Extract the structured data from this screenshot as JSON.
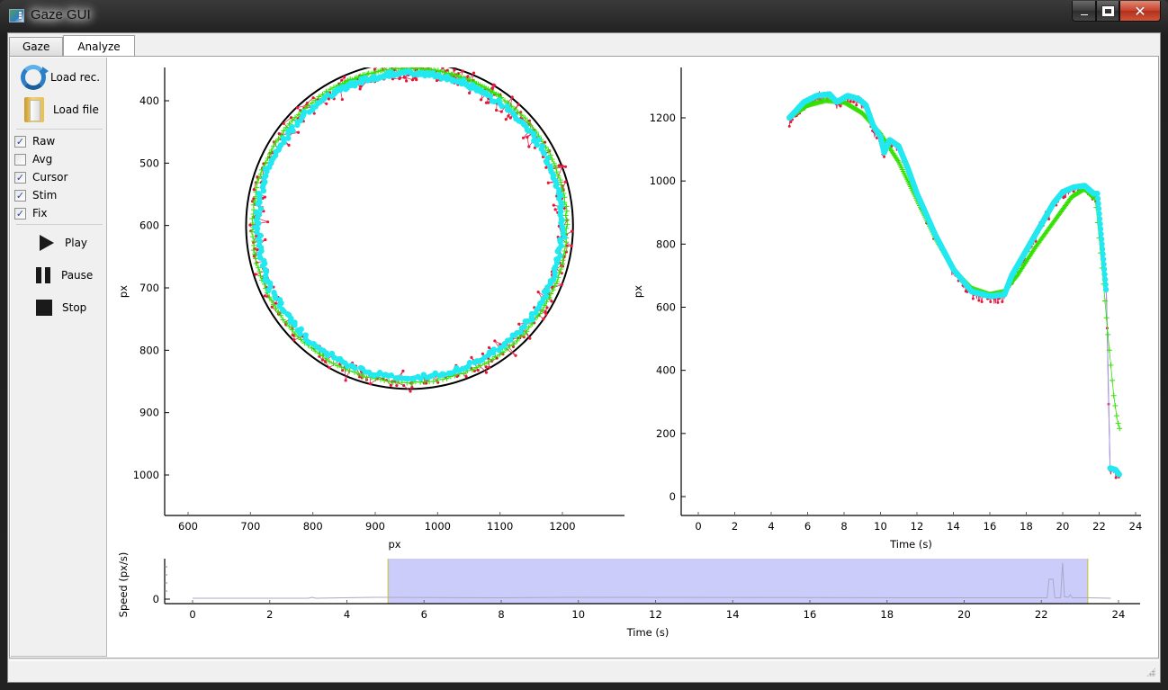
{
  "window": {
    "title": "Gaze GUI",
    "controls": {
      "minimize": "minimize",
      "maximize": "maximize",
      "close": "close"
    }
  },
  "tabs": [
    {
      "label": "Gaze",
      "active": false
    },
    {
      "label": "Analyze",
      "active": true
    }
  ],
  "sidebar": {
    "load_rec": {
      "label": "Load rec.",
      "icon": "refresh-icon"
    },
    "load_file": {
      "label": "Load file",
      "icon": "folder-icon"
    },
    "checkboxes": [
      {
        "label": "Raw",
        "checked": true
      },
      {
        "label": "Avg",
        "checked": false
      },
      {
        "label": "Cursor",
        "checked": true
      },
      {
        "label": "Stim",
        "checked": true
      },
      {
        "label": "Fix",
        "checked": true
      }
    ],
    "play": {
      "label": "Play",
      "icon": "play-icon"
    },
    "pause": {
      "label": "Pause",
      "icon": "pause-icon"
    },
    "stop": {
      "label": "Stop",
      "icon": "stop-icon"
    }
  },
  "colors": {
    "raw": "#e8173a",
    "raw_line": "#d8305a",
    "stim": "#33e000",
    "fix": "#22e8f0",
    "cursor": "#9a9af0",
    "target": "#000000",
    "selection": "#ccccfa",
    "selection_edge": "#c8c870",
    "speed_line": "#a8a8c8"
  },
  "chart_data": [
    {
      "id": "xy-plot",
      "type": "scatter",
      "title": "",
      "xlabel": "px",
      "ylabel": "px",
      "xlim": [
        565,
        1300
      ],
      "ylim": [
        345,
        1065
      ],
      "y_inverted": true,
      "xticks": [
        600,
        700,
        800,
        900,
        1000,
        1100,
        1200
      ],
      "yticks": [
        400,
        500,
        600,
        700,
        800,
        900,
        1000
      ],
      "target_circle": {
        "cx": 955,
        "cy": 600,
        "r": 262,
        "color": "#000000"
      },
      "series": [
        {
          "name": "Raw",
          "style": "dots+lines",
          "arc_deg": [
            -118,
            305
          ],
          "offset": -14,
          "noise": 24
        },
        {
          "name": "Stim",
          "style": "plus",
          "arc_deg": [
            -118,
            305
          ],
          "offset": -10,
          "noise": 2
        },
        {
          "name": "Fix",
          "style": "thick-dots",
          "arc_deg": [
            -120,
            300
          ],
          "offset": -18,
          "noise": 6
        }
      ]
    },
    {
      "id": "time-plot",
      "type": "line",
      "xlabel": "Time (s)",
      "ylabel": "px",
      "xlim": [
        -1,
        24.3
      ],
      "ylim": [
        -60,
        1340
      ],
      "xticks": [
        0,
        2,
        4,
        6,
        8,
        10,
        12,
        14,
        16,
        18,
        20,
        22,
        24
      ],
      "yticks": [
        0,
        200,
        400,
        600,
        800,
        1000,
        1200
      ],
      "series": [
        {
          "name": "Stim",
          "x": [
            5.0,
            6.0,
            7.0,
            8.0,
            9.0,
            10.0,
            11.0,
            12.0,
            13.0,
            14.0,
            15.0,
            16.0,
            16.8,
            17.5,
            18.5,
            19.5,
            20.5,
            21.2,
            21.8,
            22.2,
            22.5,
            22.8,
            23.0,
            23.2
          ],
          "y": [
            1200,
            1240,
            1255,
            1250,
            1215,
            1150,
            1060,
            940,
            820,
            720,
            660,
            640,
            650,
            700,
            790,
            870,
            950,
            975,
            940,
            700,
            500,
            320,
            240,
            200
          ]
        },
        {
          "name": "Fix",
          "x": [
            5.0,
            5.8,
            6.5,
            7.2,
            7.6,
            8.2,
            8.8,
            9.2,
            9.6,
            10.0,
            10.2,
            10.5,
            11.0,
            11.5,
            12.0,
            13.0,
            14.0,
            15.0,
            16.0,
            16.8,
            17.2,
            18.0,
            18.8,
            19.5,
            20.0,
            20.6,
            21.2,
            21.7,
            21.9,
            22.4,
            22.6,
            22.9,
            23.1
          ],
          "y": [
            1200,
            1250,
            1270,
            1275,
            1250,
            1270,
            1260,
            1240,
            1175,
            1140,
            1090,
            1130,
            1110,
            1040,
            960,
            830,
            720,
            650,
            635,
            640,
            700,
            780,
            860,
            930,
            965,
            980,
            985,
            960,
            960,
            640,
            90,
            85,
            70
          ]
        },
        {
          "name": "Raw",
          "noise": 25,
          "follows": "Fix"
        }
      ]
    },
    {
      "id": "speed-plot",
      "type": "line",
      "xlabel": "Time (s)",
      "ylabel": "Speed (px/s)",
      "xlim": [
        -0.7,
        24.3
      ],
      "xticks": [
        0,
        2,
        4,
        6,
        8,
        10,
        12,
        14,
        16,
        18,
        20,
        22,
        24
      ],
      "yticks": [
        0
      ],
      "ylim_relative": [
        0,
        1
      ],
      "selection": {
        "start": 5.07,
        "end": 23.2
      },
      "series": [
        {
          "name": "Speed",
          "x": [
            0,
            3.0,
            3.1,
            3.2,
            4.7,
            5.0,
            8.0,
            10.0,
            20.0,
            22.15,
            22.2,
            22.3,
            22.35,
            22.5,
            22.55,
            22.6,
            22.7,
            22.75,
            22.8,
            22.85,
            23.2,
            23.8
          ],
          "y": [
            0.02,
            0.02,
            0.04,
            0.02,
            0.04,
            0.04,
            0.03,
            0.04,
            0.03,
            0.03,
            0.45,
            0.45,
            0.03,
            0.03,
            0.82,
            0.05,
            0.04,
            0.1,
            0.03,
            0.03,
            0.03,
            0.02
          ]
        }
      ]
    }
  ]
}
